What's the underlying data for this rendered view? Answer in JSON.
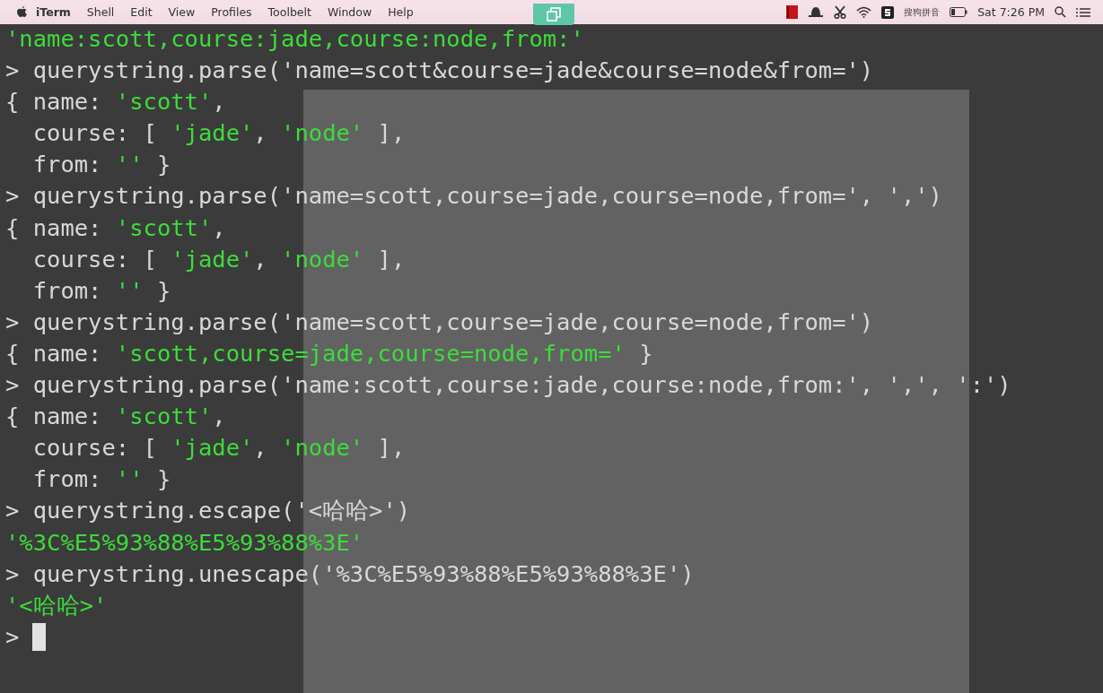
{
  "menu_bar": {
    "app": "iTerm",
    "items": [
      "Shell",
      "Edit",
      "View",
      "Profiles",
      "Toolbelt",
      "Window",
      "Help"
    ],
    "input_method": "搜狗拼音",
    "clock": "Sat 7:26 PM"
  },
  "terminal": {
    "lines": [
      [
        {
          "kind": "string",
          "text": "'name:scott,course:jade,course:node,from:'"
        }
      ],
      [
        {
          "kind": "plain",
          "text": "> querystring.parse('name=scott&course=jade&course=node&from=')"
        }
      ],
      [
        {
          "kind": "plain",
          "text": "{ name: "
        },
        {
          "kind": "string",
          "text": "'scott'"
        },
        {
          "kind": "plain",
          "text": ","
        }
      ],
      [
        {
          "kind": "plain",
          "text": "  course: [ "
        },
        {
          "kind": "string",
          "text": "'jade'"
        },
        {
          "kind": "plain",
          "text": ", "
        },
        {
          "kind": "string",
          "text": "'node'"
        },
        {
          "kind": "plain",
          "text": " ],"
        }
      ],
      [
        {
          "kind": "plain",
          "text": "  from: "
        },
        {
          "kind": "string",
          "text": "''"
        },
        {
          "kind": "plain",
          "text": " }"
        }
      ],
      [
        {
          "kind": "plain",
          "text": "> querystring.parse('name=scott,course=jade,course=node,from=', ',')"
        }
      ],
      [
        {
          "kind": "plain",
          "text": "{ name: "
        },
        {
          "kind": "string",
          "text": "'scott'"
        },
        {
          "kind": "plain",
          "text": ","
        }
      ],
      [
        {
          "kind": "plain",
          "text": "  course: [ "
        },
        {
          "kind": "string",
          "text": "'jade'"
        },
        {
          "kind": "plain",
          "text": ", "
        },
        {
          "kind": "string",
          "text": "'node'"
        },
        {
          "kind": "plain",
          "text": " ],"
        }
      ],
      [
        {
          "kind": "plain",
          "text": "  from: "
        },
        {
          "kind": "string",
          "text": "''"
        },
        {
          "kind": "plain",
          "text": " }"
        }
      ],
      [
        {
          "kind": "plain",
          "text": "> querystring.parse('name=scott,course=jade,course=node,from=')"
        }
      ],
      [
        {
          "kind": "plain",
          "text": "{ name: "
        },
        {
          "kind": "string",
          "text": "'scott,course=jade,course=node,from='"
        },
        {
          "kind": "plain",
          "text": " }"
        }
      ],
      [
        {
          "kind": "plain",
          "text": "> querystring.parse('name:scott,course:jade,course:node,from:', ',', ':')"
        }
      ],
      [
        {
          "kind": "plain",
          "text": "{ name: "
        },
        {
          "kind": "string",
          "text": "'scott'"
        },
        {
          "kind": "plain",
          "text": ","
        }
      ],
      [
        {
          "kind": "plain",
          "text": "  course: [ "
        },
        {
          "kind": "string",
          "text": "'jade'"
        },
        {
          "kind": "plain",
          "text": ", "
        },
        {
          "kind": "string",
          "text": "'node'"
        },
        {
          "kind": "plain",
          "text": " ],"
        }
      ],
      [
        {
          "kind": "plain",
          "text": "  from: "
        },
        {
          "kind": "string",
          "text": "''"
        },
        {
          "kind": "plain",
          "text": " }"
        }
      ],
      [
        {
          "kind": "plain",
          "text": "> querystring.escape('<哈哈>')"
        }
      ],
      [
        {
          "kind": "string",
          "text": "'%3C%E5%93%88%E5%93%88%3E'"
        }
      ],
      [
        {
          "kind": "plain",
          "text": "> querystring.unescape('%3C%E5%93%88%E5%93%88%3E')"
        }
      ],
      [
        {
          "kind": "string",
          "text": "'<哈哈>'"
        }
      ]
    ],
    "prompt": ">"
  }
}
